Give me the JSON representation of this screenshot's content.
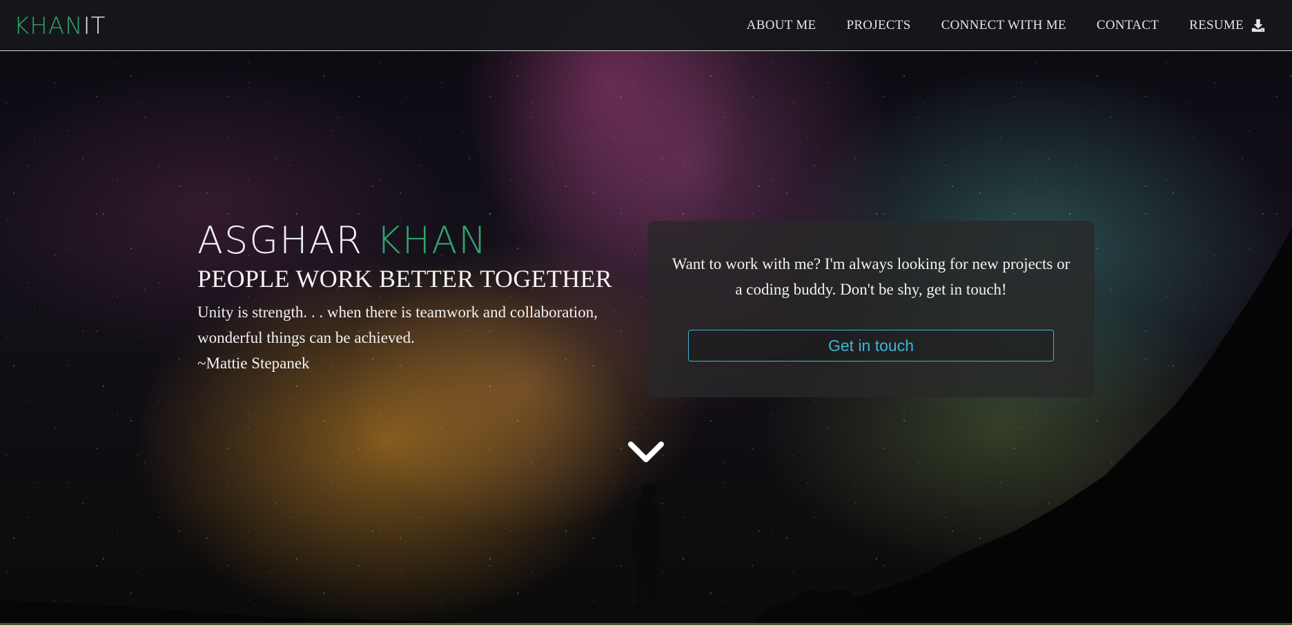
{
  "brand": {
    "part1": "KHAN",
    "part2": "IT",
    "accent_color": "#2fa36b"
  },
  "nav": {
    "items": [
      {
        "label": "ABOUT ME"
      },
      {
        "label": "PROJECTS"
      },
      {
        "label": "CONNECT WITH ME"
      },
      {
        "label": "CONTACT"
      },
      {
        "label": "RESUME",
        "icon": "download-icon"
      }
    ]
  },
  "hero": {
    "first_name": "ASGHAR",
    "last_name": "KHAN",
    "tagline": "PEOPLE WORK BETTER TOGETHER",
    "quote_line1": "Unity is strength. . . when there is teamwork and collaboration,",
    "quote_line2": "wonderful things can be achieved.",
    "author": "~Mattie Stepanek"
  },
  "card": {
    "text_line1": "Want to work with me? I'm always looking for new projects or",
    "text_line2": "a coding buddy. Don't be shy, get in touch!",
    "button_label": "Get in touch",
    "button_color": "#3fb6d6"
  },
  "scroll_icon": "chevron-down-icon"
}
